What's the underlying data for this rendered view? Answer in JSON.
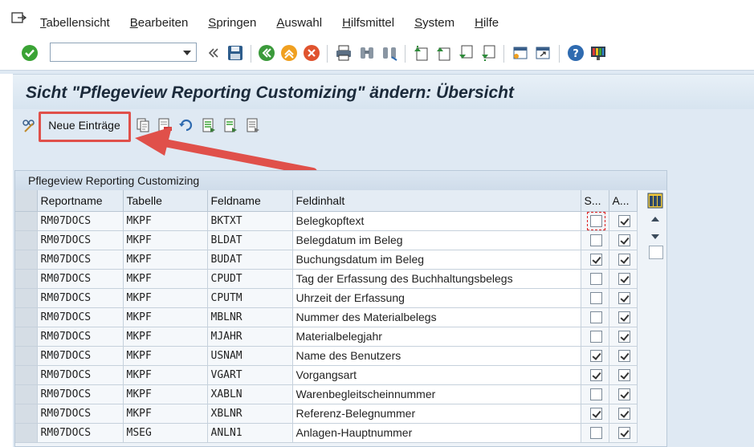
{
  "menu": {
    "items": [
      "Tabellensicht",
      "Bearbeiten",
      "Springen",
      "Auswahl",
      "Hilfsmittel",
      "System",
      "Hilfe"
    ]
  },
  "toolbar": {
    "command_field_value": "",
    "icons": [
      "confirm-icon",
      "save-icon",
      "back-icon",
      "exit-icon",
      "cancel-icon",
      "print-icon",
      "find-icon",
      "find-next-icon",
      "first-page-icon",
      "previous-page-icon",
      "next-page-icon",
      "last-page-icon",
      "new-session-icon",
      "shortcut-icon",
      "help-icon",
      "customize-layout-icon"
    ]
  },
  "title": "Sicht \"Pflegeview Reporting Customizing\" ändern: Übersicht",
  "app_toolbar": {
    "new_entries_label": "Neue Einträge"
  },
  "table": {
    "title": "Pflegeview Reporting Customizing",
    "columns": [
      "Reportname",
      "Tabelle",
      "Feldname",
      "Feldinhalt",
      "S...",
      "A..."
    ],
    "rows": [
      {
        "report": "RM07DOCS",
        "table": "MKPF",
        "field": "BKTXT",
        "content": "Belegkopftext",
        "s": false,
        "a": true,
        "focus": true
      },
      {
        "report": "RM07DOCS",
        "table": "MKPF",
        "field": "BLDAT",
        "content": "Belegdatum im Beleg",
        "s": false,
        "a": true
      },
      {
        "report": "RM07DOCS",
        "table": "MKPF",
        "field": "BUDAT",
        "content": "Buchungsdatum im Beleg",
        "s": true,
        "a": true
      },
      {
        "report": "RM07DOCS",
        "table": "MKPF",
        "field": "CPUDT",
        "content": "Tag der Erfassung des Buchhaltungsbelegs",
        "s": false,
        "a": true
      },
      {
        "report": "RM07DOCS",
        "table": "MKPF",
        "field": "CPUTM",
        "content": "Uhrzeit der Erfassung",
        "s": false,
        "a": true
      },
      {
        "report": "RM07DOCS",
        "table": "MKPF",
        "field": "MBLNR",
        "content": "Nummer des Materialbelegs",
        "s": false,
        "a": true
      },
      {
        "report": "RM07DOCS",
        "table": "MKPF",
        "field": "MJAHR",
        "content": "Materialbelegjahr",
        "s": false,
        "a": true
      },
      {
        "report": "RM07DOCS",
        "table": "MKPF",
        "field": "USNAM",
        "content": "Name des Benutzers",
        "s": true,
        "a": true
      },
      {
        "report": "RM07DOCS",
        "table": "MKPF",
        "field": "VGART",
        "content": "Vorgangsart",
        "s": true,
        "a": true
      },
      {
        "report": "RM07DOCS",
        "table": "MKPF",
        "field": "XABLN",
        "content": "Warenbegleitscheinnummer",
        "s": false,
        "a": true
      },
      {
        "report": "RM07DOCS",
        "table": "MKPF",
        "field": "XBLNR",
        "content": "Referenz-Belegnummer",
        "s": true,
        "a": true
      },
      {
        "report": "RM07DOCS",
        "table": "MSEG",
        "field": "ANLN1",
        "content": "Anlagen-Hauptnummer",
        "s": false,
        "a": true
      }
    ]
  },
  "colors": {
    "highlight": "#e0504a",
    "background": "#dfe9f3"
  }
}
